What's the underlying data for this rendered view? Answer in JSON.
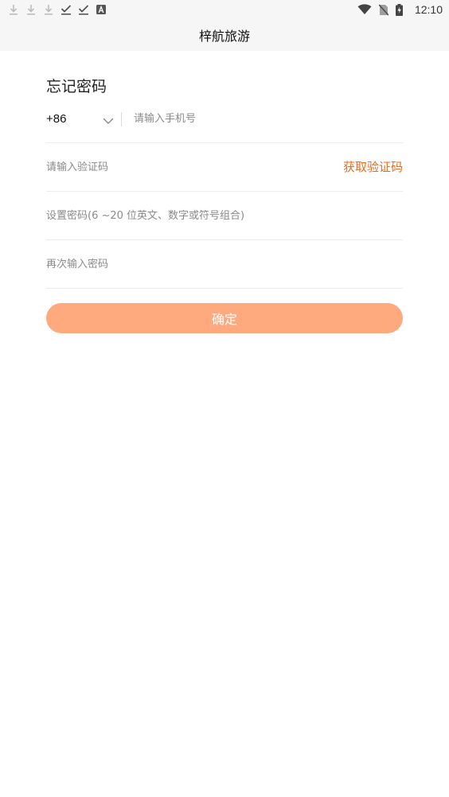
{
  "status_bar": {
    "time": "12:10",
    "left_icons": [
      "download-icon",
      "download-icon",
      "download-icon",
      "check-icon",
      "check-icon",
      "a-box-icon"
    ],
    "right_icons": [
      "wifi-icon",
      "no-sim-icon",
      "battery-charging-icon"
    ]
  },
  "app_bar": {
    "title": "梓航旅游"
  },
  "form": {
    "title": "忘记密码",
    "country_code": "+86",
    "phone_placeholder": "请输入手机号",
    "code_placeholder": "请输入验证码",
    "get_code_label": "获取验证码",
    "password_placeholder": "设置密码(6 ~20 位英文、数字或符号组合)",
    "password_confirm_placeholder": "再次输入密码",
    "confirm_label": "确定"
  },
  "colors": {
    "accent": "#f26a17",
    "button_bg": "#ffaa7e",
    "bar_bg": "#f6f6f6",
    "divider": "#ececec"
  }
}
